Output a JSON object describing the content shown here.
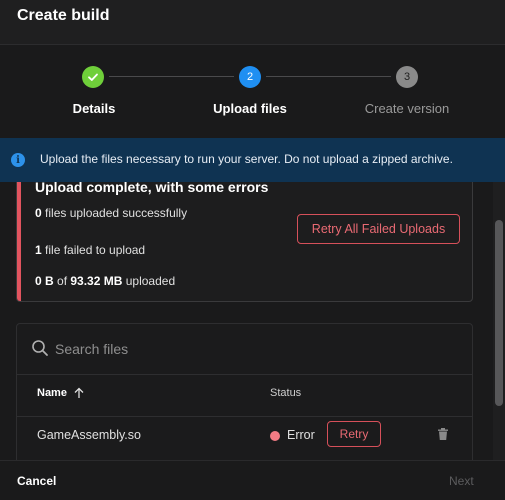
{
  "dialog": {
    "title": "Create build"
  },
  "stepper": {
    "steps": [
      {
        "label": "Details",
        "state": "complete",
        "marker": ""
      },
      {
        "label": "Upload files",
        "state": "active",
        "marker": "2"
      },
      {
        "label": "Create version",
        "state": "pending",
        "marker": "3"
      }
    ]
  },
  "info": {
    "icon": "info-icon",
    "text": "Upload the files necessary to run your server. Do not upload a zipped archive."
  },
  "upload_summary": {
    "heading": "Upload complete, with some errors",
    "success_count": "0",
    "success_text": " files uploaded successfully",
    "failed_count": "1",
    "failed_text": " file failed to upload",
    "uploaded_amount": "0 B",
    "of_text": " of ",
    "total_amount": "93.32 MB",
    "uploaded_text": " uploaded",
    "retry_all_label": "Retry All Failed Uploads"
  },
  "files": {
    "search_placeholder": "Search files",
    "columns": {
      "name": "Name",
      "status": "Status"
    },
    "rows": [
      {
        "name": "GameAssembly.so",
        "status": "Error",
        "retry_label": "Retry"
      }
    ]
  },
  "footer": {
    "cancel_label": "Cancel",
    "next_label": "Next"
  },
  "colors": {
    "accent": "#1f8ff2",
    "success": "#6fcf3a",
    "error": "#e2545f",
    "info_banner": "#0f3352"
  }
}
